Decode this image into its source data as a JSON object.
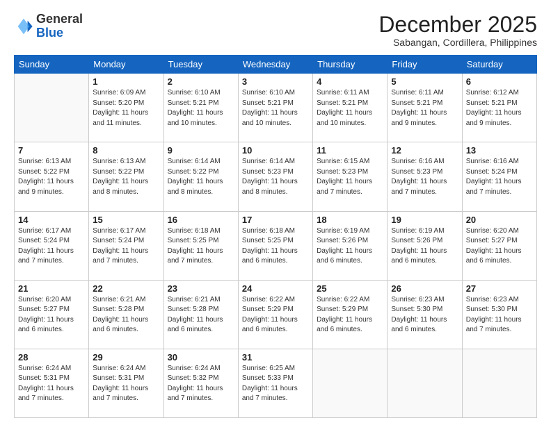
{
  "logo": {
    "general": "General",
    "blue": "Blue"
  },
  "header": {
    "month": "December 2025",
    "subtitle": "Sabangan, Cordillera, Philippines"
  },
  "weekdays": [
    "Sunday",
    "Monday",
    "Tuesday",
    "Wednesday",
    "Thursday",
    "Friday",
    "Saturday"
  ],
  "weeks": [
    [
      {
        "day": "",
        "info": ""
      },
      {
        "day": "1",
        "info": "Sunrise: 6:09 AM\nSunset: 5:20 PM\nDaylight: 11 hours\nand 11 minutes."
      },
      {
        "day": "2",
        "info": "Sunrise: 6:10 AM\nSunset: 5:21 PM\nDaylight: 11 hours\nand 10 minutes."
      },
      {
        "day": "3",
        "info": "Sunrise: 6:10 AM\nSunset: 5:21 PM\nDaylight: 11 hours\nand 10 minutes."
      },
      {
        "day": "4",
        "info": "Sunrise: 6:11 AM\nSunset: 5:21 PM\nDaylight: 11 hours\nand 10 minutes."
      },
      {
        "day": "5",
        "info": "Sunrise: 6:11 AM\nSunset: 5:21 PM\nDaylight: 11 hours\nand 9 minutes."
      },
      {
        "day": "6",
        "info": "Sunrise: 6:12 AM\nSunset: 5:21 PM\nDaylight: 11 hours\nand 9 minutes."
      }
    ],
    [
      {
        "day": "7",
        "info": "Sunrise: 6:13 AM\nSunset: 5:22 PM\nDaylight: 11 hours\nand 9 minutes."
      },
      {
        "day": "8",
        "info": "Sunrise: 6:13 AM\nSunset: 5:22 PM\nDaylight: 11 hours\nand 8 minutes."
      },
      {
        "day": "9",
        "info": "Sunrise: 6:14 AM\nSunset: 5:22 PM\nDaylight: 11 hours\nand 8 minutes."
      },
      {
        "day": "10",
        "info": "Sunrise: 6:14 AM\nSunset: 5:23 PM\nDaylight: 11 hours\nand 8 minutes."
      },
      {
        "day": "11",
        "info": "Sunrise: 6:15 AM\nSunset: 5:23 PM\nDaylight: 11 hours\nand 7 minutes."
      },
      {
        "day": "12",
        "info": "Sunrise: 6:16 AM\nSunset: 5:23 PM\nDaylight: 11 hours\nand 7 minutes."
      },
      {
        "day": "13",
        "info": "Sunrise: 6:16 AM\nSunset: 5:24 PM\nDaylight: 11 hours\nand 7 minutes."
      }
    ],
    [
      {
        "day": "14",
        "info": "Sunrise: 6:17 AM\nSunset: 5:24 PM\nDaylight: 11 hours\nand 7 minutes."
      },
      {
        "day": "15",
        "info": "Sunrise: 6:17 AM\nSunset: 5:24 PM\nDaylight: 11 hours\nand 7 minutes."
      },
      {
        "day": "16",
        "info": "Sunrise: 6:18 AM\nSunset: 5:25 PM\nDaylight: 11 hours\nand 7 minutes."
      },
      {
        "day": "17",
        "info": "Sunrise: 6:18 AM\nSunset: 5:25 PM\nDaylight: 11 hours\nand 6 minutes."
      },
      {
        "day": "18",
        "info": "Sunrise: 6:19 AM\nSunset: 5:26 PM\nDaylight: 11 hours\nand 6 minutes."
      },
      {
        "day": "19",
        "info": "Sunrise: 6:19 AM\nSunset: 5:26 PM\nDaylight: 11 hours\nand 6 minutes."
      },
      {
        "day": "20",
        "info": "Sunrise: 6:20 AM\nSunset: 5:27 PM\nDaylight: 11 hours\nand 6 minutes."
      }
    ],
    [
      {
        "day": "21",
        "info": "Sunrise: 6:20 AM\nSunset: 5:27 PM\nDaylight: 11 hours\nand 6 minutes."
      },
      {
        "day": "22",
        "info": "Sunrise: 6:21 AM\nSunset: 5:28 PM\nDaylight: 11 hours\nand 6 minutes."
      },
      {
        "day": "23",
        "info": "Sunrise: 6:21 AM\nSunset: 5:28 PM\nDaylight: 11 hours\nand 6 minutes."
      },
      {
        "day": "24",
        "info": "Sunrise: 6:22 AM\nSunset: 5:29 PM\nDaylight: 11 hours\nand 6 minutes."
      },
      {
        "day": "25",
        "info": "Sunrise: 6:22 AM\nSunset: 5:29 PM\nDaylight: 11 hours\nand 6 minutes."
      },
      {
        "day": "26",
        "info": "Sunrise: 6:23 AM\nSunset: 5:30 PM\nDaylight: 11 hours\nand 6 minutes."
      },
      {
        "day": "27",
        "info": "Sunrise: 6:23 AM\nSunset: 5:30 PM\nDaylight: 11 hours\nand 7 minutes."
      }
    ],
    [
      {
        "day": "28",
        "info": "Sunrise: 6:24 AM\nSunset: 5:31 PM\nDaylight: 11 hours\nand 7 minutes."
      },
      {
        "day": "29",
        "info": "Sunrise: 6:24 AM\nSunset: 5:31 PM\nDaylight: 11 hours\nand 7 minutes."
      },
      {
        "day": "30",
        "info": "Sunrise: 6:24 AM\nSunset: 5:32 PM\nDaylight: 11 hours\nand 7 minutes."
      },
      {
        "day": "31",
        "info": "Sunrise: 6:25 AM\nSunset: 5:33 PM\nDaylight: 11 hours\nand 7 minutes."
      },
      {
        "day": "",
        "info": ""
      },
      {
        "day": "",
        "info": ""
      },
      {
        "day": "",
        "info": ""
      }
    ]
  ]
}
